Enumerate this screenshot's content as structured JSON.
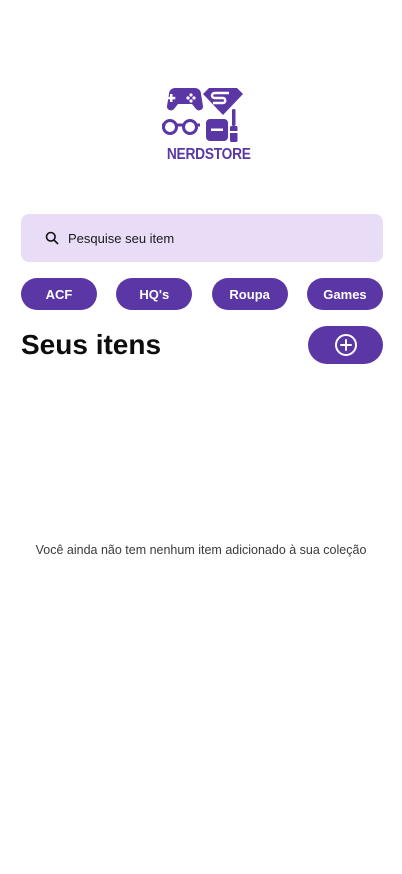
{
  "logo": {
    "text": "NERDSTORE",
    "icon": "nerdstore-logo-icon"
  },
  "search": {
    "placeholder": "Pesquise seu item",
    "icon": "search-icon"
  },
  "categories": [
    {
      "label": "ACF"
    },
    {
      "label": "HQ's"
    },
    {
      "label": "Roupa"
    },
    {
      "label": "Games"
    }
  ],
  "section": {
    "title": "Seus itens",
    "add_icon": "plus-circle-icon"
  },
  "empty_state": {
    "message": "Você ainda não tem nenhum item adicionado à sua coleção"
  },
  "colors": {
    "accent": "#5b37a6",
    "search_bg": "#e9dcf7",
    "text": "#0d0d0d"
  }
}
